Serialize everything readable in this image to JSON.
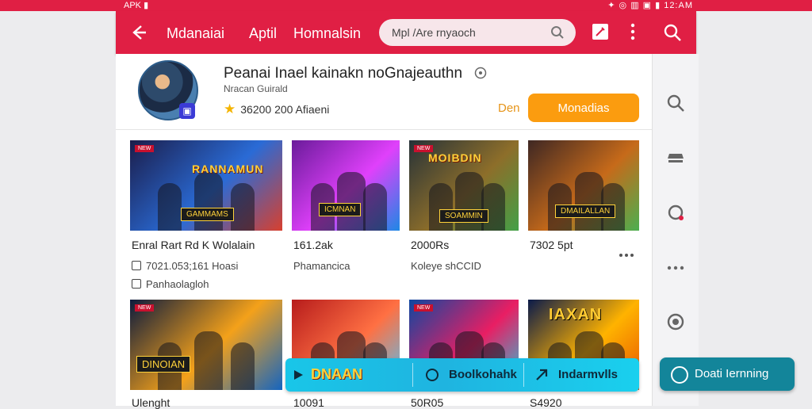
{
  "status_bar": {
    "left": "APK ▮",
    "right": "✦ ◎ ▥ ▣ ▮ 12:AM"
  },
  "app_bar": {
    "back_icon": "arrow-left",
    "tabs": [
      "Mdanaiai",
      "Aptil",
      "Homnalsin"
    ],
    "search_placeholder": "Mpl /Are rnyaoch",
    "actions": [
      "edit-square-icon",
      "more-vert-icon",
      "search-icon"
    ]
  },
  "developer": {
    "name": "Peanai Inael kainakn nοGnajeauthn",
    "subtitle": "Nracan Guirald",
    "rating": "36200 200 Afiaeni",
    "link": "Den",
    "install_label": "Monadias"
  },
  "cards": [
    {
      "art_title": "RANNAMUN",
      "banner": "GAMMAMS",
      "title": "Enral Rart Rd K Wolalain",
      "line1": "7021.053;161 Hoasi",
      "line2": "Panhaolagloh",
      "colors": [
        "#1b1d4a",
        "#2a6bd6",
        "#d8402e"
      ]
    },
    {
      "art_title": "",
      "banner": "ICMNAN",
      "title": "161.2ak",
      "line1": "Phamancica",
      "line2": "",
      "colors": [
        "#6a1b9a",
        "#e040fb",
        "#1e88e5"
      ]
    },
    {
      "art_title": "MOIBDIN",
      "banner": "SOAMMIN",
      "title": "2000Rs",
      "line1": "Koleye shCCID",
      "line2": "",
      "colors": [
        "#263238",
        "#8d6e2a",
        "#43a047"
      ]
    },
    {
      "art_title": "",
      "banner": "DMAILALLAN",
      "title": "7302 5pt",
      "line1": "",
      "line2": "",
      "colors": [
        "#3e2723",
        "#c66a1a",
        "#4caf50"
      ]
    },
    {
      "art_title": "",
      "banner": "DINOIAN",
      "title": "Ulenght",
      "line1": "",
      "line2": "",
      "colors": [
        "#0d1b3d",
        "#f4a11a",
        "#1565c0"
      ]
    },
    {
      "art_title": "",
      "banner": "",
      "title": "10091",
      "line1": "",
      "line2": "",
      "colors": [
        "#b71c1c",
        "#ff7043",
        "#4fc3f7"
      ]
    },
    {
      "art_title": "",
      "banner": "",
      "title": "50R05",
      "line1": "",
      "line2": "",
      "colors": [
        "#0d47a1",
        "#e91e63",
        "#26c6da"
      ]
    },
    {
      "art_title": "IAXAN",
      "banner": "",
      "title": "S4920",
      "line1": "",
      "line2": "",
      "colors": [
        "#0a1a4a",
        "#ffb300",
        "#e65100"
      ]
    }
  ],
  "promo_bar": {
    "segments": [
      "DNAAN",
      "Boolkohahk",
      "Indarmvlls"
    ]
  },
  "fab": {
    "label": "Doati Iernning"
  },
  "colors": {
    "brand": "#e01f44",
    "accent": "#fb9c0f",
    "fab": "#13859a"
  }
}
